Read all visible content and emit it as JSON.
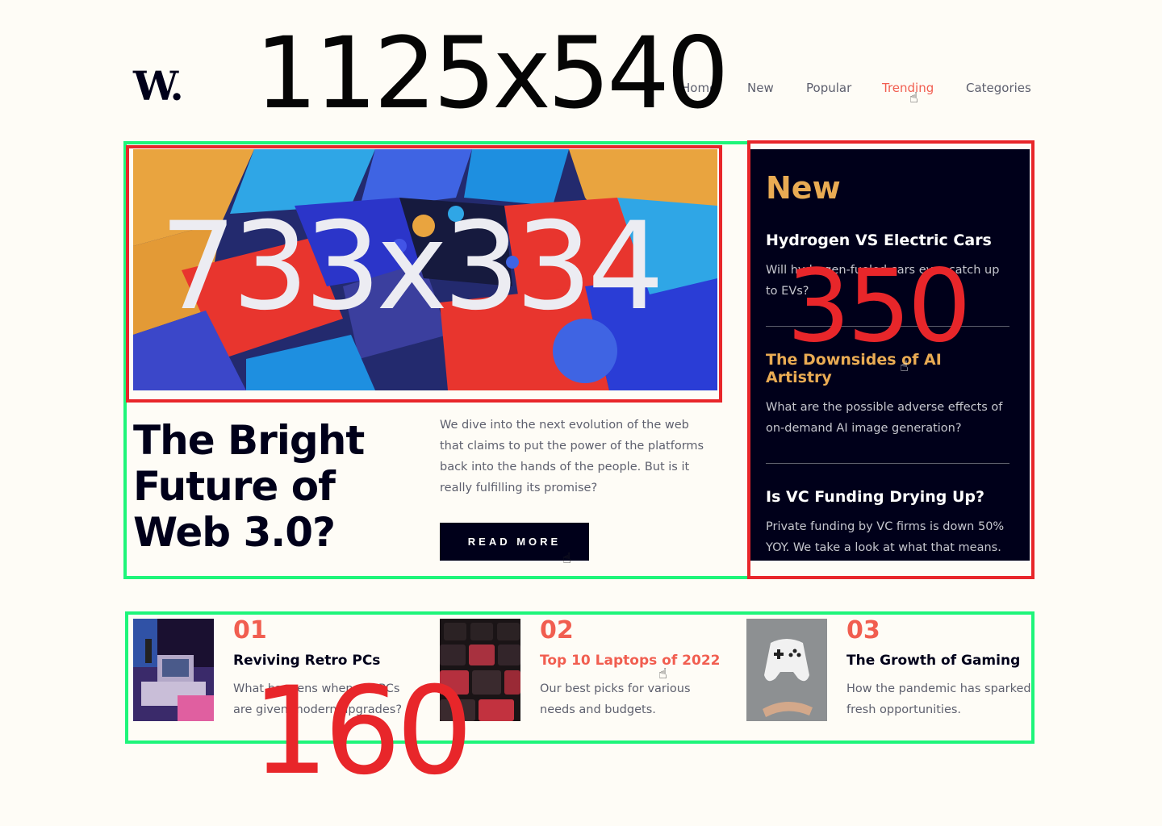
{
  "header": {
    "logo": "W.",
    "nav": [
      {
        "label": "Home"
      },
      {
        "label": "New"
      },
      {
        "label": "Popular"
      },
      {
        "label": "Trending",
        "active": true
      },
      {
        "label": "Categories"
      }
    ]
  },
  "hero": {
    "image_label": "733x334",
    "title": "The Bright Future of Web 3.0?",
    "description": "We dive into the next evolution of the web that claims to put the power of the platforms back into the hands of the people. But is it really fulfilling its promise?",
    "cta_label": "READ MORE"
  },
  "new_panel": {
    "heading": "New",
    "items": [
      {
        "title": "Hydrogen VS Electric Cars",
        "desc": "Will hydrogen-fueled cars ever catch up to EVs?"
      },
      {
        "title": "The Downsides of AI Artistry",
        "desc": "What are the possible adverse effects of on-demand AI image generation?",
        "highlighted": true
      },
      {
        "title": "Is VC Funding Drying Up?",
        "desc": "Private funding by VC firms is down 50% YOY. We take a look at what that means."
      }
    ]
  },
  "articles": [
    {
      "num": "01",
      "title": "Reviving Retro PCs",
      "desc": "What happens when old PCs are given modern upgrades?"
    },
    {
      "num": "02",
      "title": "Top 10 Laptops of 2022",
      "desc": "Our best picks for various needs and budgets.",
      "highlighted": true
    },
    {
      "num": "03",
      "title": "The Growth of Gaming",
      "desc": "How the pandemic has sparked fresh opportunities."
    }
  ],
  "annotations": {
    "page_size": "1125x540",
    "hero_size": "733x334",
    "sidebar_size": "350",
    "list_height": "160",
    "colors": {
      "green": "#1ef57a",
      "red": "#e8262a"
    }
  },
  "theme": {
    "background": "#fefcf6",
    "dark": "#00001a",
    "accent_orange": "#e9ab53",
    "accent_red": "#f15e50",
    "text_muted": "#5d5f6d"
  }
}
